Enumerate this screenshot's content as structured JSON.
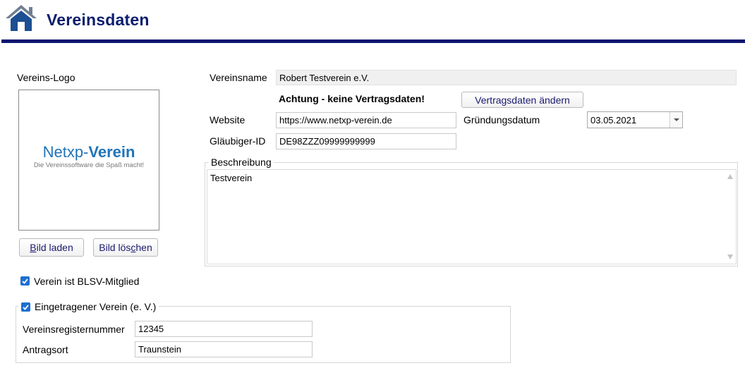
{
  "header": {
    "title": "Vereinsdaten",
    "icon": "home-icon"
  },
  "logo": {
    "section_label": "Vereins-Logo",
    "brand_prefix": "Netxp-",
    "brand_suffix": "Verein",
    "tagline": "Die Vereinssoftware die Spaß macht!",
    "load_button": {
      "pre": "",
      "hot": "B",
      "post": "ild laden"
    },
    "delete_button": {
      "pre": "Bild lös",
      "hot": "c",
      "post": "hen"
    }
  },
  "form": {
    "name_label": "Vereinsname",
    "name_value": "Robert Testverein e.V.",
    "warning": "Achtung  -  keine Vertragsdaten!",
    "contract_button": "Vertragsdaten ändern",
    "website_label": "Website",
    "website_value": "https://www.netxp-verein.de",
    "founding_label": "Gründungsdatum",
    "founding_value": "03.05.2021",
    "creditor_label": "Gläubiger-ID",
    "creditor_value": "DE98ZZZ09999999999"
  },
  "description": {
    "legend": "Beschreibung",
    "text": "Testverein"
  },
  "blsv": {
    "label": "Verein ist BLSV-Mitglied",
    "checked": true
  },
  "registered": {
    "legend": "Eingetragener Verein (e. V.)",
    "checked": true,
    "register_label": "Vereinsregisternummer",
    "register_value": "12345",
    "place_label": "Antragsort",
    "place_value": "Traunstein"
  },
  "colors": {
    "accent": "#0c1670",
    "brand_blue": "#1f74b8",
    "checkbox": "#1e6fd0"
  }
}
